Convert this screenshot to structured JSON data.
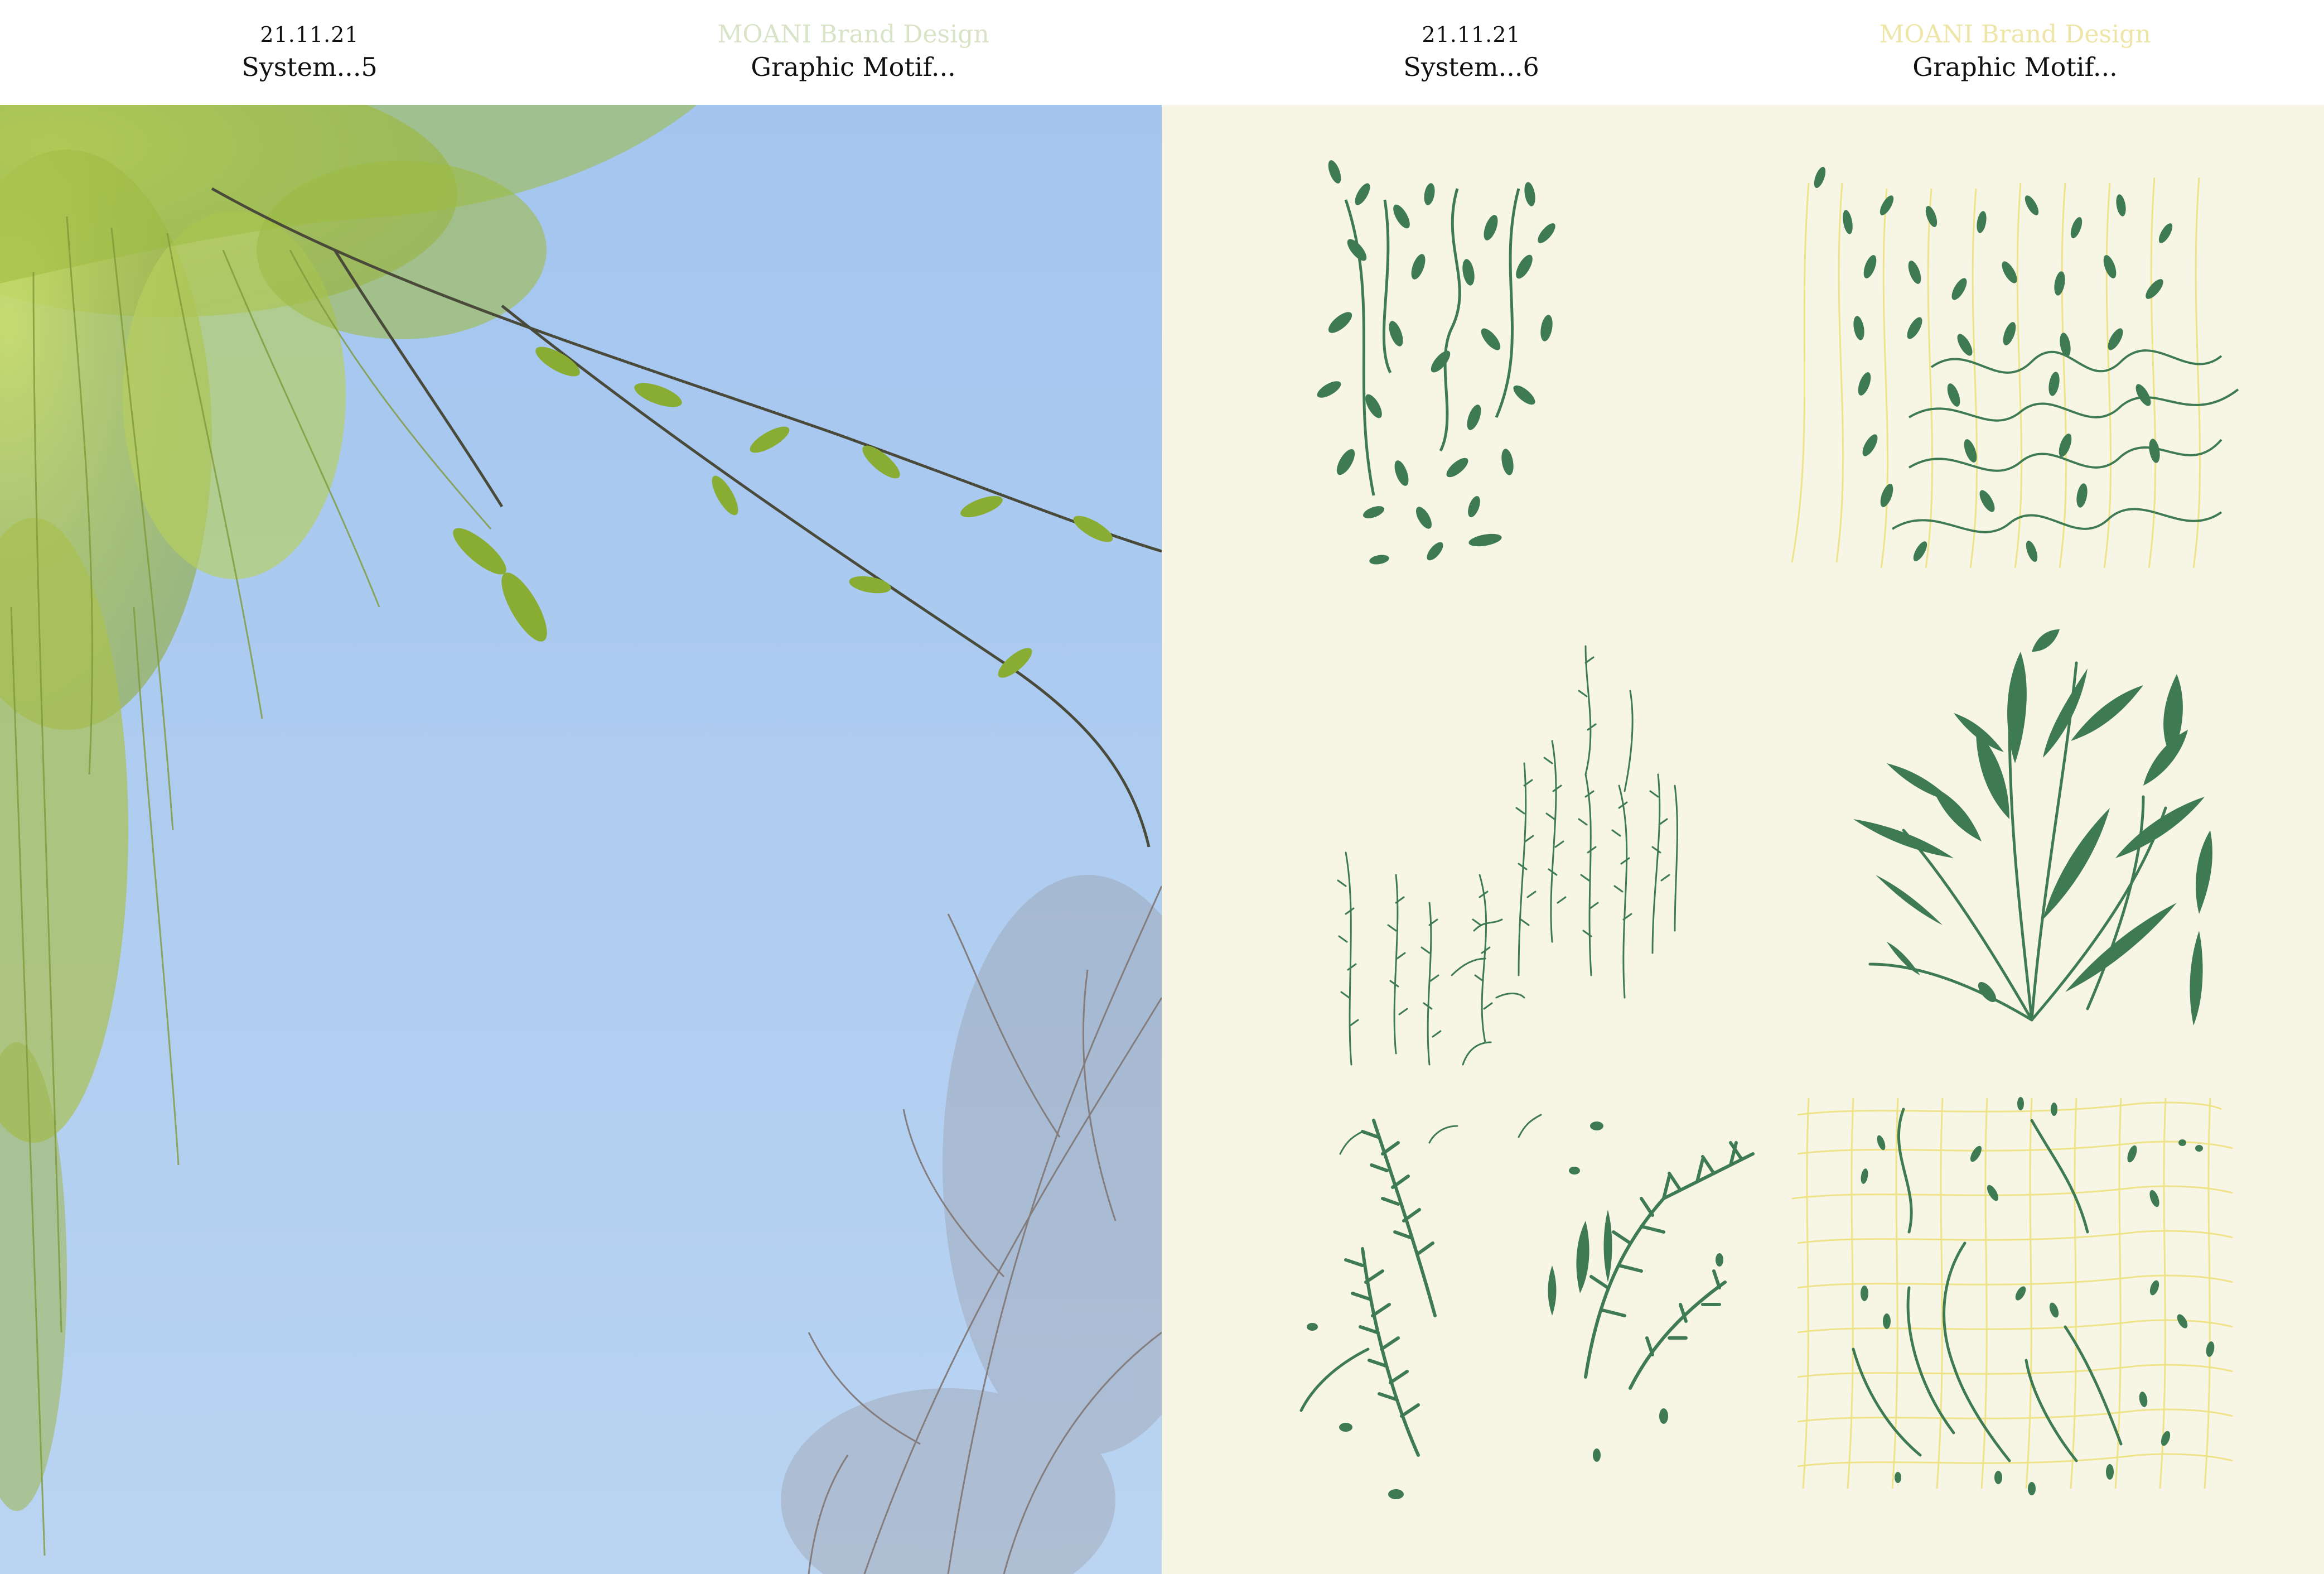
{
  "pages": [
    {
      "date": "21.11.21",
      "system": "System...5",
      "brand": "MOANI Brand Design",
      "section": "Graphic Motif..."
    },
    {
      "date": "21.11.21",
      "system": "System...6",
      "brand": "MOANI Brand Design",
      "section": "Graphic Motif..."
    }
  ],
  "colors": {
    "brand_left": "#d9e3c8",
    "brand_right": "#eee6a6",
    "sky_top": "#9fc2ee",
    "sky_bottom": "#b9d3f2",
    "motif_green": "#3e7b52",
    "motif_yellow": "#efe38a",
    "artboard_bg": "#f7f6e6"
  }
}
